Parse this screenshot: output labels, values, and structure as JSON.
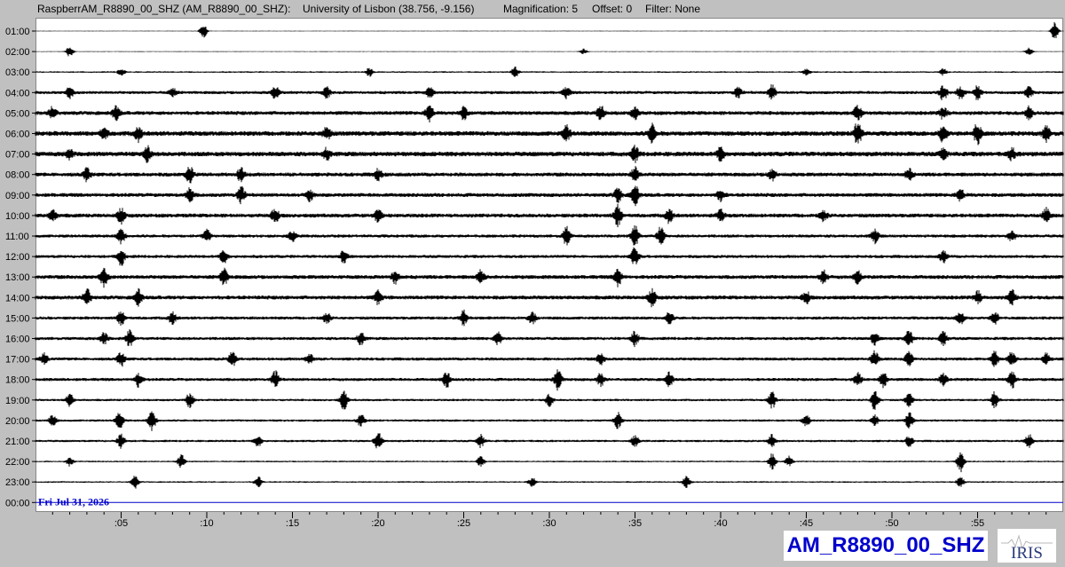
{
  "header": {
    "station": "RaspberrAM_R8890_00_SHZ (AM_R8890_00_SHZ):",
    "location": "University of Lisbon (38.756, -9.156)",
    "magnification": "Magnification: 5",
    "offset": "Offset: 0",
    "filter": "Filter: None"
  },
  "footer": {
    "station_label": "AM_R8890_00_SHZ",
    "logo_text": "IRIS",
    "logo_name": "iris-logo"
  },
  "colors": {
    "background": "#c0c0c0",
    "plot_bg": "#ffffff",
    "trace": "#000000",
    "date_text": "#0000cc",
    "station_text": "#0000cc"
  },
  "chart_data": {
    "type": "line",
    "subtype": "helicorder",
    "date_label": "Fri Jul 31, 2026",
    "y_tick_labels": [
      "01:00",
      "02:00",
      "03:00",
      "04:00",
      "05:00",
      "06:00",
      "07:00",
      "08:00",
      "09:00",
      "10:00",
      "11:00",
      "12:00",
      "13:00",
      "14:00",
      "15:00",
      "16:00",
      "17:00",
      "18:00",
      "19:00",
      "20:00",
      "21:00",
      "22:00",
      "23:00",
      "00:00"
    ],
    "x_tick_labels": [
      ":05",
      ":10",
      ":15",
      ":20",
      ":25",
      ":30",
      ":35",
      ":40",
      ":45",
      ":50",
      ":55"
    ],
    "x_range_minutes": [
      0,
      60
    ],
    "row_amplitude": [
      1,
      1,
      2,
      4,
      5,
      6,
      6,
      5,
      5,
      5,
      4,
      4,
      5,
      5,
      4,
      4,
      4,
      4,
      3,
      3,
      3,
      2,
      2,
      0
    ],
    "events": [
      [
        [
          9.8,
          8
        ],
        [
          59.5,
          10
        ]
      ],
      [
        [
          2,
          6
        ],
        [
          32,
          3
        ],
        [
          58,
          4
        ]
      ],
      [
        [
          5,
          4
        ],
        [
          19.5,
          5
        ],
        [
          28,
          6
        ],
        [
          45,
          4
        ],
        [
          53,
          4
        ]
      ],
      [
        [
          2,
          6
        ],
        [
          8,
          5
        ],
        [
          14,
          7
        ],
        [
          17,
          6
        ],
        [
          23,
          6
        ],
        [
          31,
          6
        ],
        [
          41,
          6
        ],
        [
          43,
          8
        ],
        [
          53,
          9
        ],
        [
          54,
          7
        ],
        [
          55,
          8
        ],
        [
          58,
          6
        ]
      ],
      [
        [
          1,
          7
        ],
        [
          4.7,
          8
        ],
        [
          23,
          10
        ],
        [
          25,
          7
        ],
        [
          33,
          8
        ],
        [
          35,
          6
        ],
        [
          48,
          9
        ],
        [
          53,
          7
        ],
        [
          58,
          7
        ]
      ],
      [
        [
          4,
          6
        ],
        [
          6,
          8
        ],
        [
          17,
          7
        ],
        [
          31,
          8
        ],
        [
          36,
          10
        ],
        [
          48,
          14
        ],
        [
          53,
          10
        ],
        [
          55,
          12
        ],
        [
          59,
          8
        ]
      ],
      [
        [
          2,
          5
        ],
        [
          6.5,
          9
        ],
        [
          17,
          6
        ],
        [
          35,
          8
        ],
        [
          40,
          7
        ],
        [
          53,
          6
        ],
        [
          57,
          6
        ]
      ],
      [
        [
          3,
          7
        ],
        [
          9,
          9
        ],
        [
          12,
          8
        ],
        [
          20,
          6
        ],
        [
          35,
          8
        ],
        [
          43,
          6
        ],
        [
          51,
          6
        ]
      ],
      [
        [
          9,
          8
        ],
        [
          12,
          9
        ],
        [
          16,
          6
        ],
        [
          34,
          8
        ],
        [
          35,
          12
        ],
        [
          40,
          6
        ],
        [
          54,
          7
        ]
      ],
      [
        [
          1,
          6
        ],
        [
          5,
          9
        ],
        [
          14,
          8
        ],
        [
          20,
          7
        ],
        [
          34,
          12
        ],
        [
          37,
          8
        ],
        [
          40,
          6
        ],
        [
          46,
          6
        ],
        [
          59,
          8
        ]
      ],
      [
        [
          5,
          9
        ],
        [
          10,
          7
        ],
        [
          15,
          6
        ],
        [
          31,
          10
        ],
        [
          35,
          12
        ],
        [
          36.5,
          10
        ],
        [
          49,
          8
        ],
        [
          57,
          6
        ]
      ],
      [
        [
          5,
          10
        ],
        [
          11,
          7
        ],
        [
          18,
          7
        ],
        [
          35,
          11
        ],
        [
          53,
          7
        ]
      ],
      [
        [
          4,
          10
        ],
        [
          11,
          9
        ],
        [
          21,
          7
        ],
        [
          26,
          7
        ],
        [
          34,
          10
        ],
        [
          46,
          7
        ],
        [
          48,
          7
        ]
      ],
      [
        [
          3,
          10
        ],
        [
          6,
          9
        ],
        [
          20,
          7
        ],
        [
          36,
          10
        ],
        [
          45,
          7
        ],
        [
          55,
          7
        ],
        [
          57,
          8
        ]
      ],
      [
        [
          5,
          8
        ],
        [
          8,
          7
        ],
        [
          17,
          6
        ],
        [
          25,
          8
        ],
        [
          29,
          7
        ],
        [
          37,
          7
        ],
        [
          54,
          8
        ],
        [
          56,
          7
        ]
      ],
      [
        [
          4,
          7
        ],
        [
          5.5,
          9
        ],
        [
          19,
          7
        ],
        [
          27,
          7
        ],
        [
          35,
          8
        ],
        [
          49,
          7
        ],
        [
          51,
          9
        ],
        [
          53,
          8
        ]
      ],
      [
        [
          0.5,
          6
        ],
        [
          5,
          8
        ],
        [
          11.5,
          8
        ],
        [
          16,
          6
        ],
        [
          33,
          6
        ],
        [
          49,
          9
        ],
        [
          51,
          9
        ],
        [
          56,
          8
        ],
        [
          57,
          8
        ],
        [
          59,
          6
        ]
      ],
      [
        [
          6,
          8
        ],
        [
          14,
          9
        ],
        [
          24,
          9
        ],
        [
          30.5,
          11
        ],
        [
          33,
          7
        ],
        [
          37,
          8
        ],
        [
          48,
          8
        ],
        [
          49.5,
          9
        ],
        [
          53,
          7
        ],
        [
          57,
          10
        ]
      ],
      [
        [
          2,
          7
        ],
        [
          9,
          8
        ],
        [
          18,
          11
        ],
        [
          30,
          7
        ],
        [
          43,
          10
        ],
        [
          49,
          12
        ],
        [
          51,
          8
        ],
        [
          56,
          9
        ]
      ],
      [
        [
          1,
          6
        ],
        [
          4.9,
          10
        ],
        [
          6.8,
          12
        ],
        [
          19,
          7
        ],
        [
          34,
          9
        ],
        [
          45,
          7
        ],
        [
          49,
          6
        ],
        [
          51,
          9
        ]
      ],
      [
        [
          5,
          8
        ],
        [
          13,
          6
        ],
        [
          20,
          10
        ],
        [
          26,
          7
        ],
        [
          35,
          6
        ],
        [
          43,
          7
        ],
        [
          51,
          6
        ],
        [
          58,
          8
        ]
      ],
      [
        [
          2,
          5
        ],
        [
          8.5,
          8
        ],
        [
          26,
          6
        ],
        [
          43,
          9
        ],
        [
          44,
          6
        ],
        [
          54,
          12
        ]
      ],
      [
        [
          5.8,
          7
        ],
        [
          13,
          6
        ],
        [
          29,
          5
        ],
        [
          38,
          7
        ],
        [
          54,
          6
        ]
      ],
      []
    ]
  }
}
